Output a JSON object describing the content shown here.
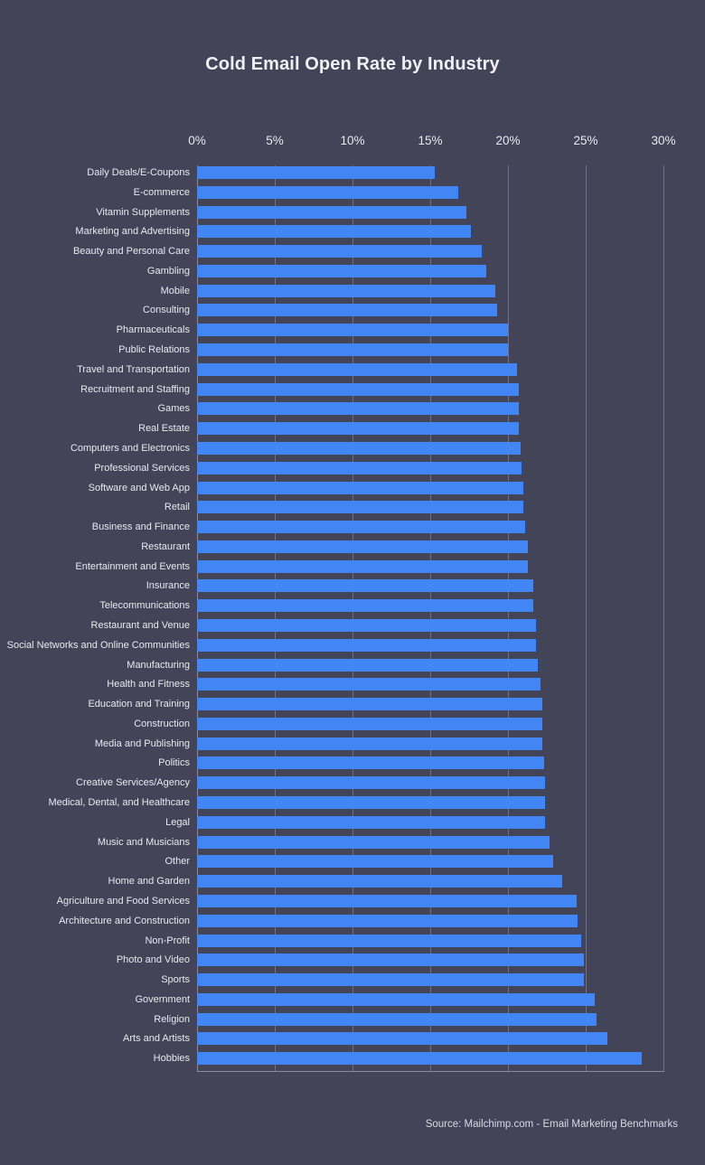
{
  "chart_data": {
    "type": "bar",
    "orientation": "horizontal",
    "title": "Cold Email Open Rate by Industry",
    "subtitle": "",
    "xlabel": "",
    "ylabel": "",
    "xlim": [
      0,
      30
    ],
    "xticks": [
      0,
      5,
      10,
      15,
      20,
      25,
      30
    ],
    "xtick_labels": [
      "0%",
      "5%",
      "10%",
      "15%",
      "20%",
      "25%",
      "30%"
    ],
    "grid": true,
    "legend": false,
    "value_unit": "%",
    "bar_color": "#4285f4",
    "background_color": "#434458",
    "text_color": "#e9e9ef",
    "gridline_color": "#6f7086",
    "source": "Source: Mailchimp.com - Email Marketing Benchmarks",
    "categories": [
      "Daily Deals/E-Coupons",
      "E-commerce",
      "Vitamin Supplements",
      "Marketing and Advertising",
      "Beauty and Personal Care",
      "Gambling",
      "Mobile",
      "Consulting",
      "Pharmaceuticals",
      "Public Relations",
      "Travel and Transportation",
      "Recruitment and Staffing",
      "Games",
      "Real Estate",
      "Computers and Electronics",
      "Professional Services",
      "Software and Web App",
      "Retail",
      "Business and Finance",
      "Restaurant",
      "Entertainment and Events",
      "Insurance",
      "Telecommunications",
      "Restaurant and Venue",
      "Social Networks and Online Communities",
      "Manufacturing",
      "Health and Fitness",
      "Education and Training",
      "Construction",
      "Media and Publishing",
      "Politics",
      "Creative Services/Agency",
      "Medical, Dental, and Healthcare",
      "Legal",
      "Music and Musicians",
      "Other",
      "Home and Garden",
      "Agriculture and Food Services",
      "Architecture and Construction",
      "Non-Profit",
      "Photo and Video",
      "Sports",
      "Government",
      "Religion",
      "Arts and Artists",
      "Hobbies"
    ],
    "values": [
      15.3,
      16.8,
      17.3,
      17.6,
      18.3,
      18.6,
      19.2,
      19.3,
      20.0,
      20.0,
      20.6,
      20.7,
      20.7,
      20.7,
      20.8,
      20.9,
      21.0,
      21.0,
      21.1,
      21.3,
      21.3,
      21.6,
      21.6,
      21.8,
      21.8,
      21.9,
      22.1,
      22.2,
      22.2,
      22.2,
      22.3,
      22.4,
      22.4,
      22.4,
      22.7,
      22.9,
      23.5,
      24.4,
      24.5,
      24.7,
      24.9,
      24.9,
      25.6,
      25.7,
      26.4,
      28.6
    ]
  },
  "footer": {
    "source_text": "Source: Mailchimp.com - Email Marketing Benchmarks"
  }
}
